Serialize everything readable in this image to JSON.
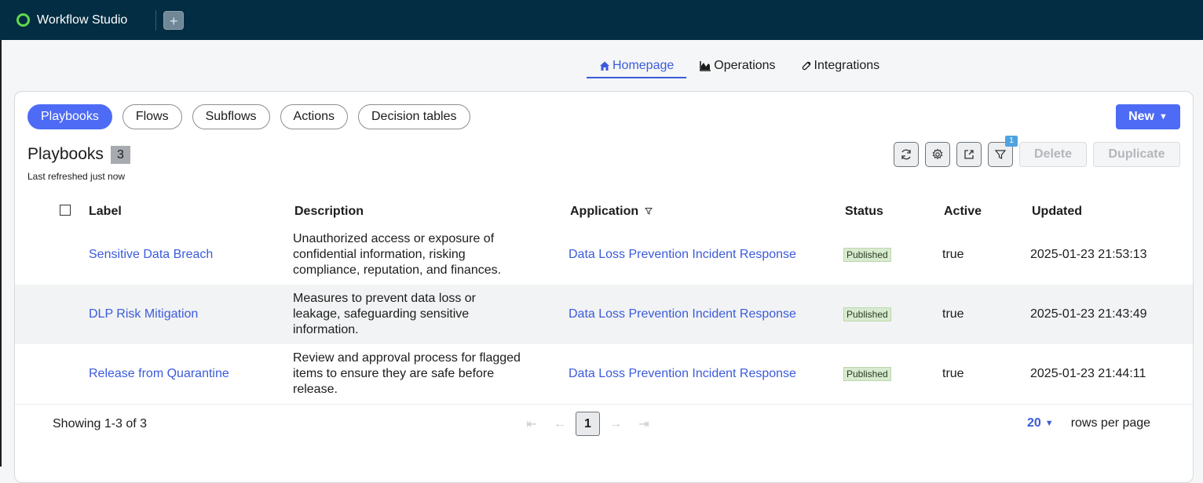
{
  "app": {
    "title": "Workflow Studio",
    "add_tab": "+"
  },
  "nav": {
    "tabs": [
      {
        "label": "Homepage",
        "icon": "home-icon",
        "active": true
      },
      {
        "label": "Operations",
        "icon": "chart-icon",
        "active": false
      },
      {
        "label": "Integrations",
        "icon": "link-icon",
        "active": false
      }
    ]
  },
  "filters": {
    "pills": [
      "Playbooks",
      "Flows",
      "Subflows",
      "Actions",
      "Decision tables"
    ],
    "active": "Playbooks"
  },
  "toolbar": {
    "new_label": "New",
    "delete_label": "Delete",
    "duplicate_label": "Duplicate",
    "filter_count": "1"
  },
  "list": {
    "title": "Playbooks",
    "count": "3",
    "refreshed": "Last refreshed just now",
    "columns": [
      "Label",
      "Description",
      "Application",
      "Status",
      "Active",
      "Updated"
    ],
    "rows": [
      {
        "label": "Sensitive Data Breach",
        "description": "Unauthorized access or exposure of confidential information, risking compliance, reputation, and finances.",
        "application": "Data Loss Prevention Incident Response",
        "status": "Published",
        "active": "true",
        "updated": "2025-01-23 21:53:13"
      },
      {
        "label": "DLP Risk Mitigation",
        "description": "Measures to prevent data loss or leakage, safeguarding sensitive information.",
        "application": "Data Loss Prevention Incident Response",
        "status": "Published",
        "active": "true",
        "updated": "2025-01-23 21:43:49"
      },
      {
        "label": "Release from Quarantine",
        "description": "Review and approval process for flagged items to ensure they are safe before release.",
        "application": "Data Loss Prevention Incident Response",
        "status": "Published",
        "active": "true",
        "updated": "2025-01-23 21:44:11"
      }
    ]
  },
  "pagination": {
    "showing": "Showing 1-3 of 3",
    "current_page": "1",
    "per_page": "20",
    "per_page_label": "rows per page"
  },
  "colors": {
    "topbar": "#032d42",
    "accent": "#4d6bf5",
    "link": "#3b5bdb",
    "status_bg": "#d8ebcf"
  }
}
